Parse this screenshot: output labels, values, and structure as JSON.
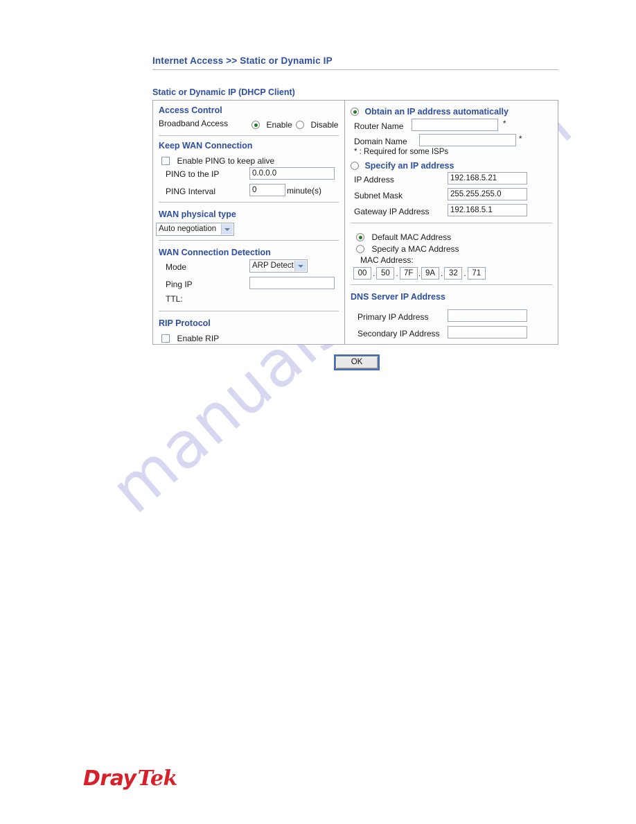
{
  "breadcrumb": {
    "parent": "Internet Access",
    "separator": ">>",
    "current": "Static or Dynamic IP"
  },
  "section_title": "Static or Dynamic IP (DHCP Client)",
  "left_panel": {
    "access_control": {
      "heading": "Access Control",
      "broadband_label": "Broadband Access",
      "enable_label": "Enable",
      "disable_label": "Disable",
      "selected": "Enable"
    },
    "keep_wan": {
      "heading": "Keep WAN Connection",
      "enable_ping_label": "Enable PING to keep alive",
      "enable_ping_checked": false,
      "ping_ip_label": "PING to the IP",
      "ping_ip_value": "0.0.0.0",
      "ping_interval_label": "PING Interval",
      "ping_interval_value": "0",
      "ping_interval_unit": "minute(s)"
    },
    "wan_physical": {
      "heading": "WAN physical type",
      "selected": "Auto negotiation"
    },
    "wan_detection": {
      "heading": "WAN Connection Detection",
      "mode_label": "Mode",
      "mode_selected": "ARP Detect",
      "ping_ip_label": "Ping IP",
      "ping_ip_value": "",
      "ttl_label": "TTL:",
      "ttl_value": ""
    },
    "rip": {
      "heading": "RIP Protocol",
      "enable_rip_label": "Enable RIP",
      "enable_rip_checked": false
    }
  },
  "right_panel": {
    "obtain_auto": {
      "label": "Obtain an IP address automatically",
      "selected": true,
      "router_name_label": "Router Name",
      "router_name_value": "",
      "router_name_marker": "*",
      "domain_name_label": "Domain Name",
      "domain_name_value": "",
      "domain_name_marker": "*",
      "note": "* : Required for some ISPs"
    },
    "specify_ip": {
      "label": "Specify an IP address",
      "selected": false,
      "ip_address_label": "IP Address",
      "ip_address_value": "192.168.5.21",
      "subnet_mask_label": "Subnet Mask",
      "subnet_mask_value": "255.255.255.0",
      "gateway_label": "Gateway IP Address",
      "gateway_value": "192.168.5.1"
    },
    "mac": {
      "default_label": "Default MAC Address",
      "specify_label": "Specify a MAC Address",
      "selected": "Default MAC Address",
      "mac_address_label": "MAC Address:",
      "octets": [
        "00",
        "50",
        "7F",
        "9A",
        "32",
        "71"
      ]
    },
    "dns": {
      "heading": "DNS Server IP Address",
      "primary_label": "Primary IP Address",
      "primary_value": "",
      "secondary_label": "Secondary IP Address",
      "secondary_value": ""
    }
  },
  "ok_button": "OK",
  "watermark": "manualshive.com",
  "logo": {
    "part1": "Dray",
    "part2": "Tek"
  },
  "colors": {
    "heading_blue": "#2d4ea2",
    "logo_red": "#d8202a",
    "radio_green": "#1f7a1f",
    "watermark": "#c9c9ee"
  }
}
